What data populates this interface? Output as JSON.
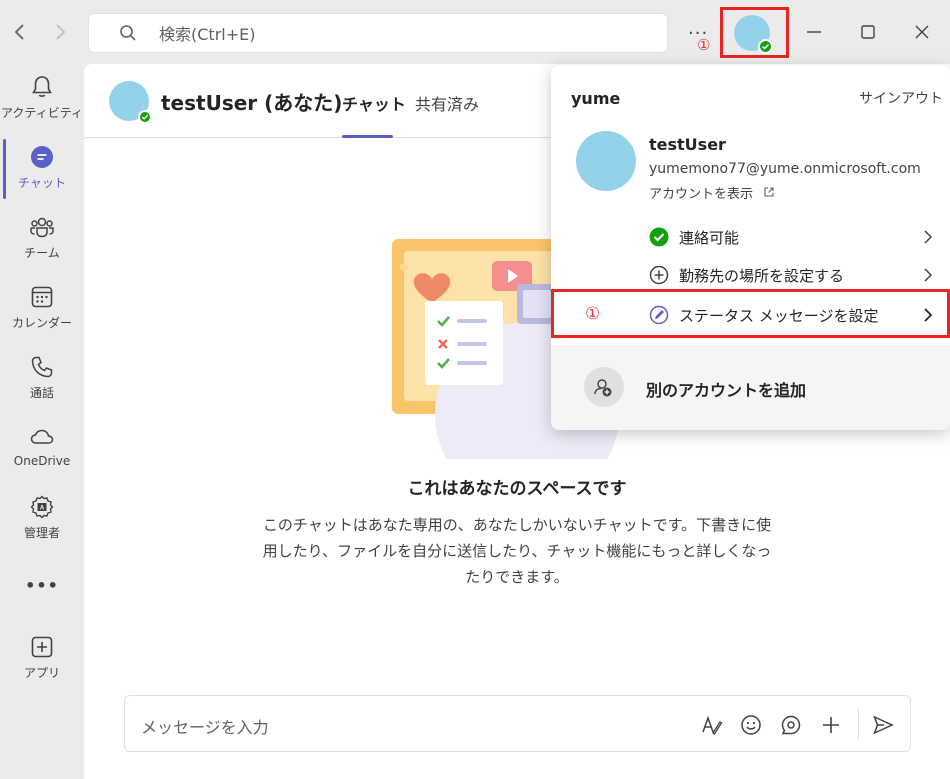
{
  "titlebar": {
    "search_placeholder": "検索(Ctrl+E)",
    "more": "...",
    "annotation": "①"
  },
  "rail": {
    "items": [
      {
        "label": "アクティビティ",
        "icon": "bell-icon"
      },
      {
        "label": "チャット",
        "icon": "chat-icon",
        "active": true
      },
      {
        "label": "チーム",
        "icon": "teams-icon"
      },
      {
        "label": "カレンダー",
        "icon": "calendar-icon"
      },
      {
        "label": "通話",
        "icon": "phone-icon"
      },
      {
        "label": "OneDrive",
        "icon": "cloud-icon"
      },
      {
        "label": "管理者",
        "icon": "admin-icon"
      },
      {
        "label": "•••",
        "icon": "more-icon"
      },
      {
        "label": "アプリ",
        "icon": "apps-icon"
      }
    ]
  },
  "chat": {
    "user_name": "testUser (あなた)",
    "tabs": [
      "チャット",
      "共有済み"
    ],
    "empty_title": "これはあなたのスペースです",
    "empty_description": "このチャットはあなた専用の、あなたしかいないチャットです。下書きに使用したり、ファイルを自分に送信したり、チャット機能にもっと詳しくなったりできます。",
    "composer_placeholder": "メッセージを入力"
  },
  "popup": {
    "org": "yume",
    "signout": "サインアウト",
    "name": "testUser",
    "email": "yumemono77@yume.onmicrosoft.com",
    "view_account": "アカウントを表示",
    "menu": [
      {
        "label": "連絡可能",
        "icon": "available-icon"
      },
      {
        "label": "勤務先の場所を設定する",
        "icon": "location-add-icon"
      },
      {
        "label": "ステータス メッセージを設定",
        "icon": "pen-icon"
      }
    ],
    "annotation": "①",
    "add_account": "別のアカウントを追加"
  },
  "colors": {
    "accent": "#5b5fc7",
    "presence": "#13a10e",
    "highlight": "#e8251f",
    "avatar": "#94d2ec"
  }
}
